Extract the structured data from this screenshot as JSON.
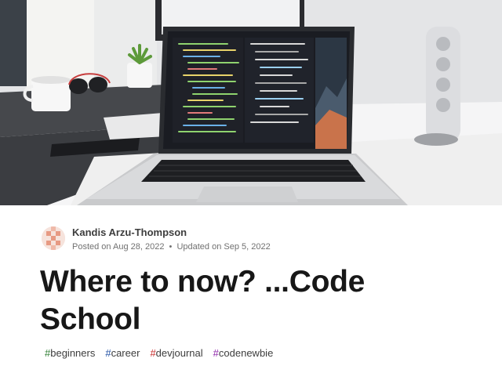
{
  "author": {
    "name": "Kandis Arzu-Thompson",
    "posted_label": "Posted on",
    "posted_date": "Aug 28, 2022",
    "separator": "•",
    "updated_label": "Updated on",
    "updated_date": "Sep 5, 2022"
  },
  "article": {
    "title": "Where to now? ...Code School"
  },
  "tags": [
    {
      "hash": "#",
      "name": "beginners",
      "color": "#2e7d32"
    },
    {
      "hash": "#",
      "name": "career",
      "color": "#1f4fa3"
    },
    {
      "hash": "#",
      "name": "devjournal",
      "color": "#c62828"
    },
    {
      "hash": "#",
      "name": "codenewbie",
      "color": "#8e24aa"
    }
  ],
  "colors": {
    "title": "#171717",
    "meta": "#717171",
    "author": "#3d3d3d"
  },
  "cover": {
    "icon": "laptop-on-desk-photo"
  }
}
